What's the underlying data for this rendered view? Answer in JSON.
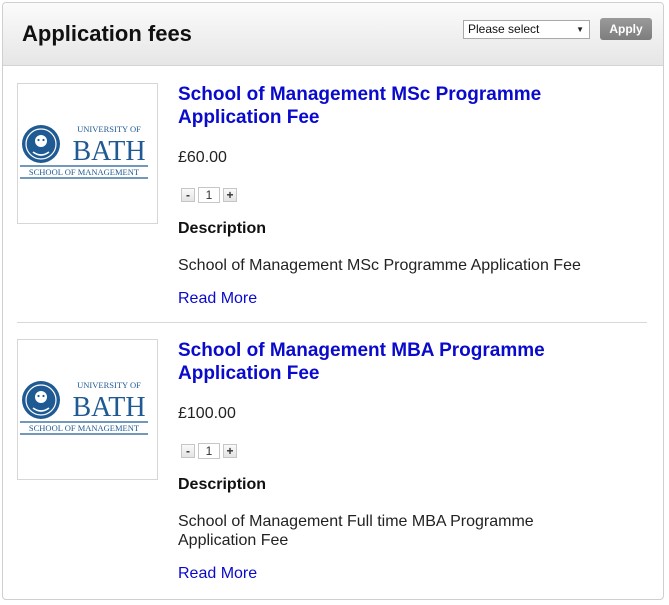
{
  "header": {
    "title": "Application fees",
    "select_value": "Please select",
    "apply_label": "Apply"
  },
  "logo": {
    "line1": "UNIVERSITY OF",
    "line2": "BATH",
    "line3": "SCHOOL OF MANAGEMENT"
  },
  "colors": {
    "link": "#0a0acc",
    "logo_blue": "#1f5a93"
  },
  "products": [
    {
      "title": "School of Management MSc Programme Application Fee",
      "price": "£60.00",
      "qty": "1",
      "minus": "-",
      "plus": "+",
      "description_heading": "Description",
      "description": "School of Management MSc Programme Application Fee",
      "read_more": "Read More"
    },
    {
      "title": "School of Management MBA Programme Application Fee",
      "price": "£100.00",
      "qty": "1",
      "minus": "-",
      "plus": "+",
      "description_heading": "Description",
      "description": "School of Management Full time MBA Programme Application Fee",
      "read_more": "Read More"
    }
  ]
}
